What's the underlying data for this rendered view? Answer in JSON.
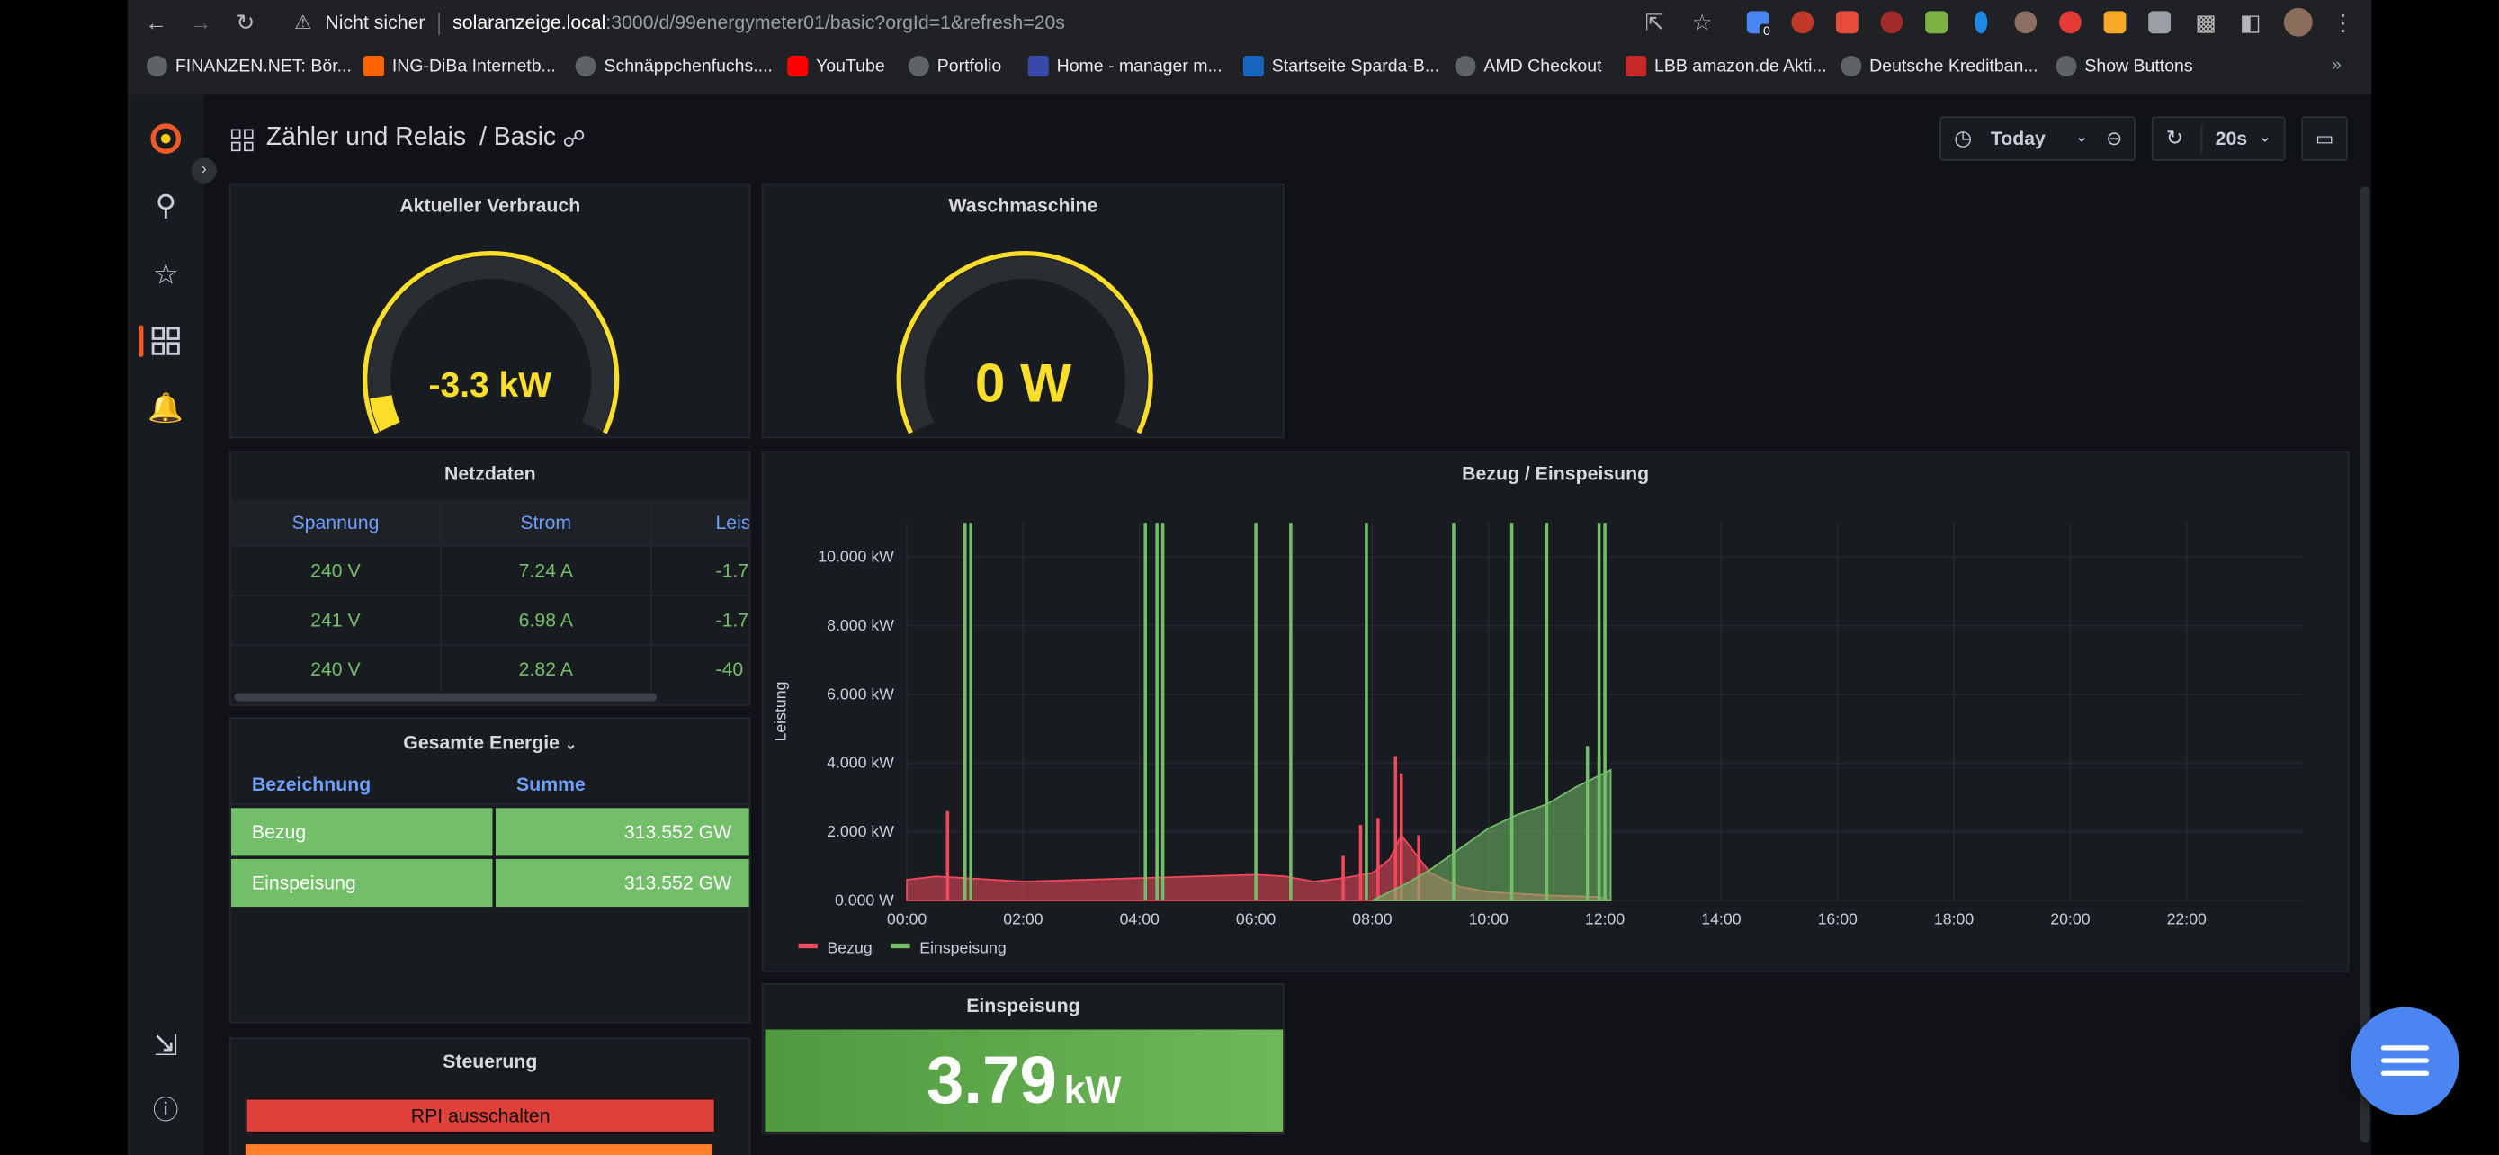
{
  "browser": {
    "insecure_label": "Nicht sicher",
    "url_host": "solaranzeige.local",
    "url_path": ":3000/d/99energymeter01/basic?orgId=1&refresh=20s",
    "extension_badge": "0",
    "bookmarks": [
      {
        "label": "FINANZEN.NET: Bör..."
      },
      {
        "label": "ING-DiBa Internetb..."
      },
      {
        "label": "Schnäppchenfuchs...."
      },
      {
        "label": "YouTube"
      },
      {
        "label": "Portfolio"
      },
      {
        "label": "Home - manager m..."
      },
      {
        "label": "Startseite Sparda-B..."
      },
      {
        "label": "AMD Checkout"
      },
      {
        "label": "LBB amazon.de Akti..."
      },
      {
        "label": "Deutsche Kreditban..."
      },
      {
        "label": "Show Buttons"
      }
    ]
  },
  "dashboard": {
    "folder": "Zähler und Relais",
    "title": "/ Basic",
    "time_range": "Today",
    "refresh": "20s"
  },
  "panels": {
    "verbrauch": {
      "title": "Aktueller Verbrauch",
      "value": "-3.3 kW",
      "gauge_fraction": 0.07,
      "color": "#fade2a"
    },
    "waschmaschine": {
      "title": "Waschmaschine",
      "value": "0 W",
      "gauge_fraction": 0.0,
      "color": "#fade2a"
    },
    "netzdaten": {
      "title": "Netzdaten",
      "headers": [
        "Spannung",
        "Strom",
        "Leis"
      ],
      "rows": [
        [
          "240 V",
          "7.24 A",
          "-1.7"
        ],
        [
          "241 V",
          "6.98 A",
          "-1.7"
        ],
        [
          "240 V",
          "2.82 A",
          "-40"
        ]
      ]
    },
    "energie": {
      "title": "Gesamte Energie",
      "headers": [
        "Bezeichnung",
        "Summe"
      ],
      "rows": [
        [
          "Bezug",
          "313.552 GW"
        ],
        [
          "Einspeisung",
          "313.552 GW"
        ]
      ]
    },
    "einspeisung": {
      "title": "Einspeisung",
      "value": "3.79",
      "unit": "kW",
      "color": "#5ea447"
    },
    "steuerung": {
      "title": "Steuerung",
      "button": "RPI ausschalten"
    }
  },
  "chart_data": {
    "type": "area",
    "title": "Bezug / Einspeisung",
    "ylabel": "Leistung",
    "xlabel": "",
    "x_ticks": [
      "00:00",
      "02:00",
      "04:00",
      "06:00",
      "08:00",
      "10:00",
      "12:00",
      "14:00",
      "16:00",
      "18:00",
      "20:00",
      "22:00"
    ],
    "y_ticks": [
      "0.000 W",
      "2.000 kW",
      "4.000 kW",
      "6.000 kW",
      "8.000 kW",
      "10.000 kW"
    ],
    "xlim": [
      0,
      24
    ],
    "ylim": [
      0,
      11000
    ],
    "grid": true,
    "legend_placement": "bottom-left",
    "series": [
      {
        "name": "Bezug",
        "color": "#f2495c",
        "baseline": [
          [
            0,
            600
          ],
          [
            0.5,
            700
          ],
          [
            1,
            650
          ],
          [
            2,
            550
          ],
          [
            3,
            600
          ],
          [
            4,
            650
          ],
          [
            5,
            700
          ],
          [
            6,
            750
          ],
          [
            6.5,
            700
          ],
          [
            7,
            550
          ],
          [
            7.5,
            650
          ],
          [
            8,
            800
          ],
          [
            8.3,
            1200
          ],
          [
            8.5,
            1900
          ],
          [
            9,
            800
          ],
          [
            9.5,
            400
          ],
          [
            10,
            250
          ],
          [
            11,
            150
          ],
          [
            11.9,
            100
          ],
          [
            12.1,
            0
          ]
        ],
        "spikes": [
          [
            0.7,
            2600
          ],
          [
            4.3,
            1500
          ],
          [
            7.5,
            1300
          ],
          [
            7.8,
            2200
          ],
          [
            8.1,
            2400
          ],
          [
            8.4,
            4200
          ],
          [
            8.5,
            3700
          ],
          [
            8.8,
            1900
          ]
        ]
      },
      {
        "name": "Einspeisung",
        "color": "#73bf69",
        "baseline": [
          [
            8,
            0
          ],
          [
            8.6,
            500
          ],
          [
            9,
            900
          ],
          [
            9.5,
            1500
          ],
          [
            10,
            2100
          ],
          [
            10.5,
            2500
          ],
          [
            11,
            2800
          ],
          [
            11.5,
            3300
          ],
          [
            12.1,
            3800
          ],
          [
            12.1,
            0
          ]
        ],
        "spikes": [
          [
            1.0,
            11000
          ],
          [
            1.1,
            11000
          ],
          [
            4.1,
            11000
          ],
          [
            4.3,
            11000
          ],
          [
            4.4,
            11000
          ],
          [
            6.0,
            11000
          ],
          [
            6.6,
            11000
          ],
          [
            7.9,
            11000
          ],
          [
            9.4,
            11000
          ],
          [
            10.4,
            11000
          ],
          [
            11.0,
            11000
          ],
          [
            11.9,
            11000
          ],
          [
            12.0,
            11000
          ],
          [
            11.7,
            4500
          ],
          [
            11.9,
            4200
          ]
        ]
      }
    ]
  }
}
